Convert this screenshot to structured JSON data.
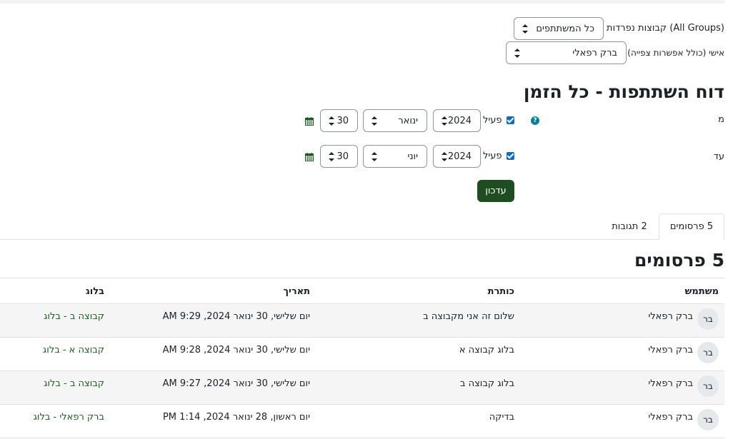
{
  "filters": {
    "separate_groups_label": "קבוצות נפרדות (All Groups)",
    "group_select_value": "כל המשתתפים",
    "user_label": "אישי (כולל אפשרות צפייה)",
    "user_select_value": "ברק רפאלי"
  },
  "report": {
    "title": "דוח השתתפות - כל הזמן",
    "from": {
      "label": "מ",
      "enabled_label": "פעיל",
      "day": "30",
      "month": "ינואר",
      "year": "2024"
    },
    "to": {
      "label": "עד",
      "enabled_label": "פעיל",
      "day": "30",
      "month": "יוני",
      "year": "2024"
    },
    "update_button": "עדכון"
  },
  "tabs": [
    {
      "label": "5 פרסומים",
      "active": true
    },
    {
      "label": "2 תגובות",
      "active": false
    }
  ],
  "posts": {
    "heading": "5 פרסומים",
    "columns": {
      "user": "משתמש",
      "subject": "כותרת",
      "date": "תאריך",
      "blog": "בלוג"
    },
    "rows": [
      {
        "initials": "בר",
        "user": "ברק רפאלי",
        "subject": "שלום זה אני מקבוצה ב",
        "date": "יום שלישי, 30 ינואר 2024, 9:29 AM",
        "blog": "קבוצה ב - בלוג"
      },
      {
        "initials": "בר",
        "user": "ברק רפאלי",
        "subject": "בלוג קבוצה א",
        "date": "יום שלישי, 30 ינואר 2024, 9:28 AM",
        "blog": "קבוצה א - בלוג"
      },
      {
        "initials": "בר",
        "user": "ברק רפאלי",
        "subject": "בלוג קבוצה ב",
        "date": "יום שלישי, 30 ינואר 2024, 9:27 AM",
        "blog": "קבוצה ב - בלוג"
      },
      {
        "initials": "בר",
        "user": "ברק רפאלי",
        "subject": "בדיקה",
        "date": "יום ראשון, 28 ינואר 2024, 1:14 PM",
        "blog": "ברק רפאלי - בלוג"
      }
    ]
  },
  "colors": {
    "primary_button": "#1e4d21",
    "link": "#1e5c22",
    "checkbox": "#0f6cbf",
    "help_icon": "#008196"
  }
}
